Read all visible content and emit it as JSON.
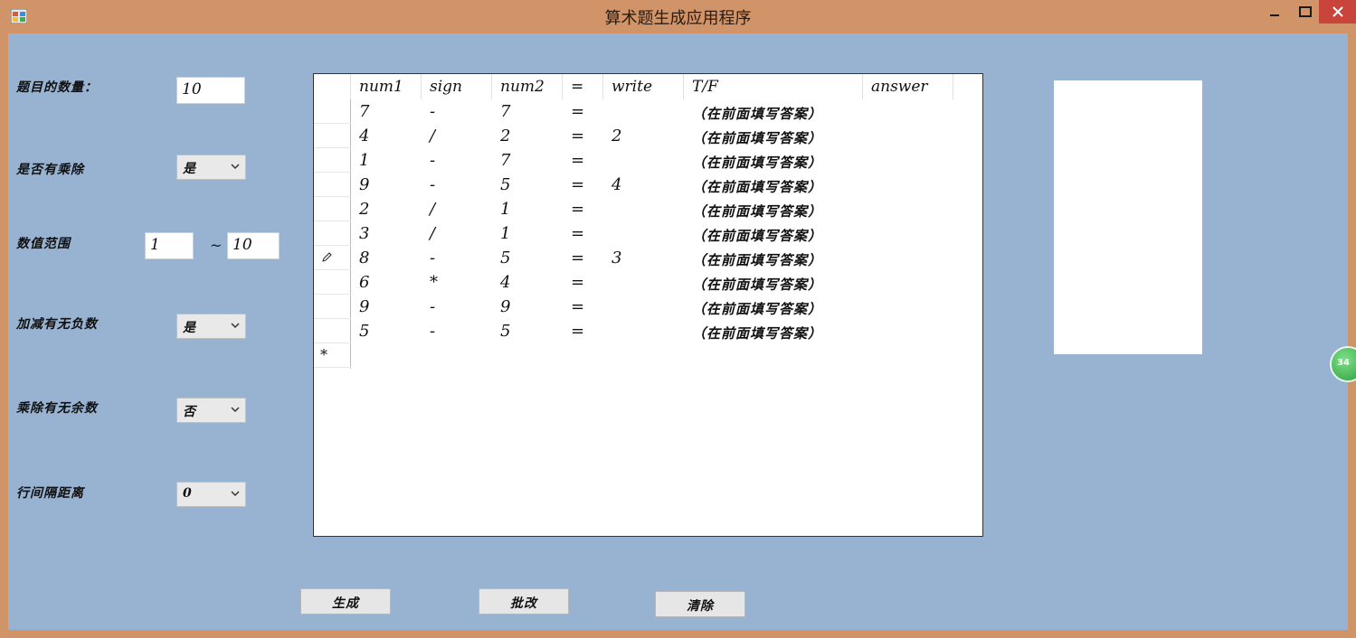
{
  "window": {
    "title": "算术题生成应用程序"
  },
  "form": {
    "count_label": "题目的数量：",
    "count_value": "10",
    "muldiv_label": "是否有乘除",
    "muldiv_value": "是",
    "range_label": "数值范围",
    "range_min": "1",
    "range_sep": "~",
    "range_max": "10",
    "negative_label": "加减有无负数",
    "negative_value": "是",
    "remainder_label": "乘除有无余数",
    "remainder_value": "否",
    "spacing_label": "行间隔距离",
    "spacing_value": "0"
  },
  "grid": {
    "columns": [
      "num1",
      "sign",
      "num2",
      "=",
      "write",
      "T/F",
      "answer"
    ],
    "rows": [
      {
        "num1": "7",
        "sign": "-",
        "num2": "7",
        "eq": "=",
        "write": "",
        "tf": "（在前面填写答案）",
        "answer": ""
      },
      {
        "num1": "4",
        "sign": "/",
        "num2": "2",
        "eq": "=",
        "write": "2",
        "tf": "（在前面填写答案）",
        "answer": ""
      },
      {
        "num1": "1",
        "sign": "-",
        "num2": "7",
        "eq": "=",
        "write": "",
        "tf": "（在前面填写答案）",
        "answer": ""
      },
      {
        "num1": "9",
        "sign": "-",
        "num2": "5",
        "eq": "=",
        "write": "4",
        "tf": "（在前面填写答案）",
        "answer": ""
      },
      {
        "num1": "2",
        "sign": "/",
        "num2": "1",
        "eq": "=",
        "write": "",
        "tf": "（在前面填写答案）",
        "answer": ""
      },
      {
        "num1": "3",
        "sign": "/",
        "num2": "1",
        "eq": "=",
        "write": "",
        "tf": "（在前面填写答案）",
        "answer": ""
      },
      {
        "num1": "8",
        "sign": "-",
        "num2": "5",
        "eq": "=",
        "write": "3",
        "tf": "（在前面填写答案）",
        "answer": ""
      },
      {
        "num1": "6",
        "sign": "*",
        "num2": "4",
        "eq": "=",
        "write": "",
        "tf": "（在前面填写答案）",
        "answer": ""
      },
      {
        "num1": "9",
        "sign": "-",
        "num2": "9",
        "eq": "=",
        "write": "",
        "tf": "（在前面填写答案）",
        "answer": ""
      },
      {
        "num1": "5",
        "sign": "-",
        "num2": "5",
        "eq": "=",
        "write": "",
        "tf": "（在前面填写答案）",
        "answer": ""
      }
    ],
    "new_row_marker": "*"
  },
  "buttons": {
    "generate": "生成",
    "grade": "批改",
    "clear": "清除"
  },
  "badge": {
    "value": "34"
  },
  "colors": {
    "titlebar": "#d09468",
    "client": "#98b3d2",
    "close_button": "#c9453c"
  }
}
